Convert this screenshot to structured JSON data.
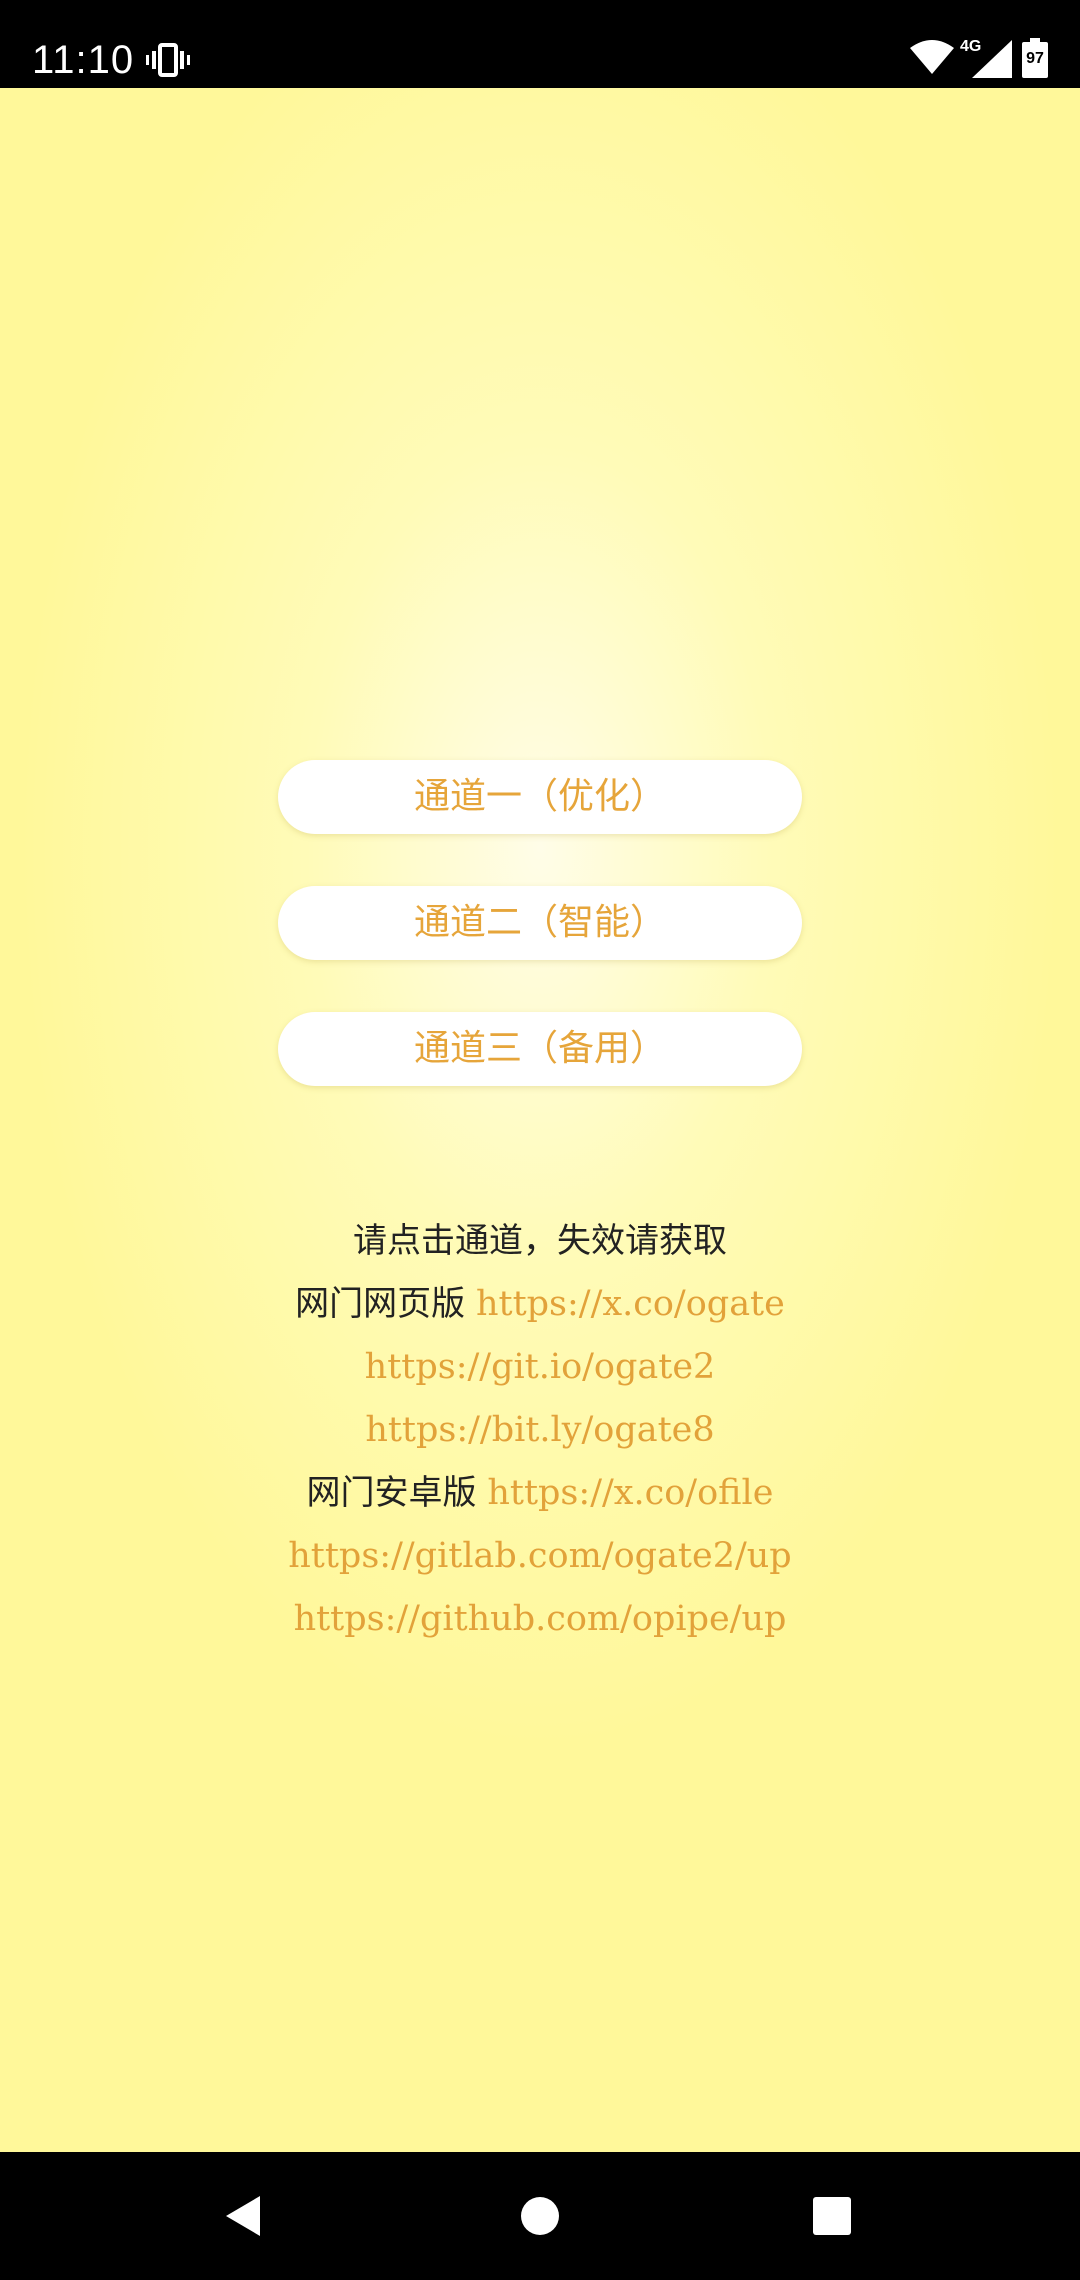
{
  "status_bar": {
    "time": "11:10",
    "network_type": "4G",
    "battery_level": "97",
    "icons": [
      "vibrate-icon",
      "wifi-icon",
      "signal-icon",
      "battery-icon"
    ]
  },
  "channels": [
    {
      "label": "通道一（优化）"
    },
    {
      "label": "通道二（智能）"
    },
    {
      "label": "通道三（备用）"
    }
  ],
  "info": {
    "instruction": "请点击通道，失效请获取",
    "web_label": "网门网页版",
    "web_link_1": "https://x.co/ogate",
    "web_link_2": "https://git.io/ogate2",
    "web_link_3": "https://bit.ly/ogate8",
    "android_label": "网门安卓版",
    "android_link_1": "https://x.co/ofile",
    "android_link_2": "https://gitlab.com/ogate2/up",
    "android_link_3": "https://github.com/opipe/up"
  },
  "colors": {
    "background_center": "#fffde8",
    "background_edge": "#fff89a",
    "accent": "#e2a23a",
    "button_bg": "#ffffff"
  },
  "nav_bar": {
    "icons": [
      "back-icon",
      "home-icon",
      "recents-icon"
    ]
  }
}
